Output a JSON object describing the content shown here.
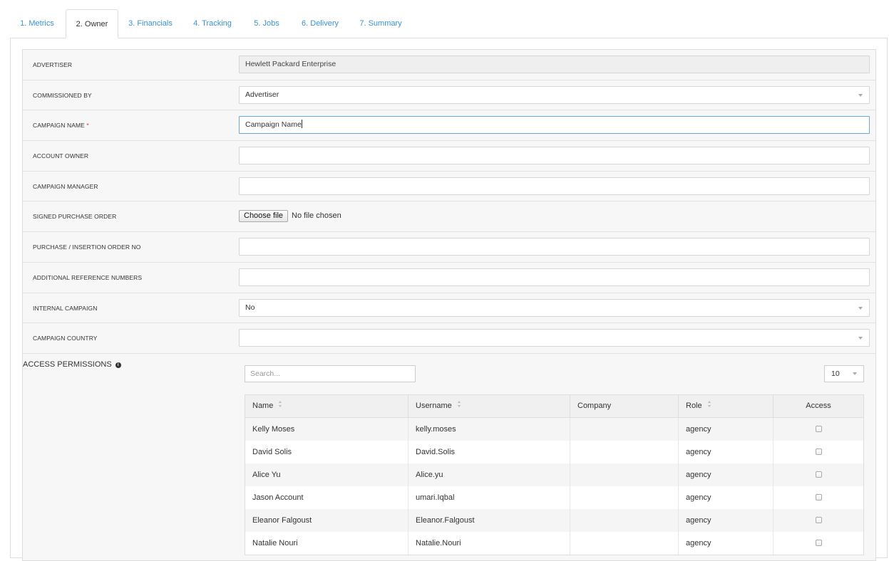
{
  "tabs": [
    {
      "label": "1. Metrics"
    },
    {
      "label": "2. Owner"
    },
    {
      "label": "3. Financials"
    },
    {
      "label": "4. Tracking"
    },
    {
      "label": "5. Jobs"
    },
    {
      "label": "6. Delivery"
    },
    {
      "label": "7. Summary"
    }
  ],
  "form": {
    "advertiser": {
      "label": "ADVERTISER",
      "value": "Hewlett Packard Enterprise"
    },
    "commissioned_by": {
      "label": "COMMISSIONED BY",
      "value": "Advertiser"
    },
    "campaign_name": {
      "label": "CAMPAIGN NAME",
      "required_mark": "*",
      "value": "Campaign Name"
    },
    "account_owner": {
      "label": "ACCOUNT OWNER",
      "value": ""
    },
    "campaign_manager": {
      "label": "CAMPAIGN MANAGER",
      "value": ""
    },
    "signed_po": {
      "label": "SIGNED PURCHASE ORDER",
      "button": "Choose file",
      "status": "No file chosen"
    },
    "po_number": {
      "label": "PURCHASE / INSERTION ORDER NO",
      "value": ""
    },
    "additional_refs": {
      "label": "ADDITIONAL REFERENCE NUMBERS",
      "value": ""
    },
    "internal_campaign": {
      "label": "INTERNAL CAMPAIGN",
      "value": "No"
    },
    "campaign_country": {
      "label": "CAMPAIGN COUNTRY",
      "value": ""
    },
    "access_permissions": {
      "label": "ACCESS PERMISSIONS",
      "info_icon": "info-circle-icon"
    }
  },
  "permissions": {
    "search_placeholder": "Search...",
    "page_size": "10",
    "columns": [
      "Name",
      "Username",
      "Company",
      "Role",
      "Access"
    ],
    "rows": [
      {
        "name": "Kelly Moses",
        "username": "kelly.moses",
        "company": "",
        "role": "agency",
        "access": false
      },
      {
        "name": "David Solis",
        "username": "David.Solis",
        "company": "",
        "role": "agency",
        "access": false
      },
      {
        "name": "Alice Yu",
        "username": "Alice.yu",
        "company": "",
        "role": "agency",
        "access": false
      },
      {
        "name": "Jason Account",
        "username": "umari.Iqbal",
        "company": "",
        "role": "agency",
        "access": false
      },
      {
        "name": "Eleanor Falgoust",
        "username": "Eleanor.Falgoust",
        "company": "",
        "role": "agency",
        "access": false
      },
      {
        "name": "Natalie Nouri",
        "username": "Natalie.Nouri",
        "company": "",
        "role": "agency",
        "access": false
      }
    ]
  },
  "colors": {
    "link": "#3a93d4",
    "focus_border": "#6aa7d8",
    "required": "#dd3333"
  }
}
